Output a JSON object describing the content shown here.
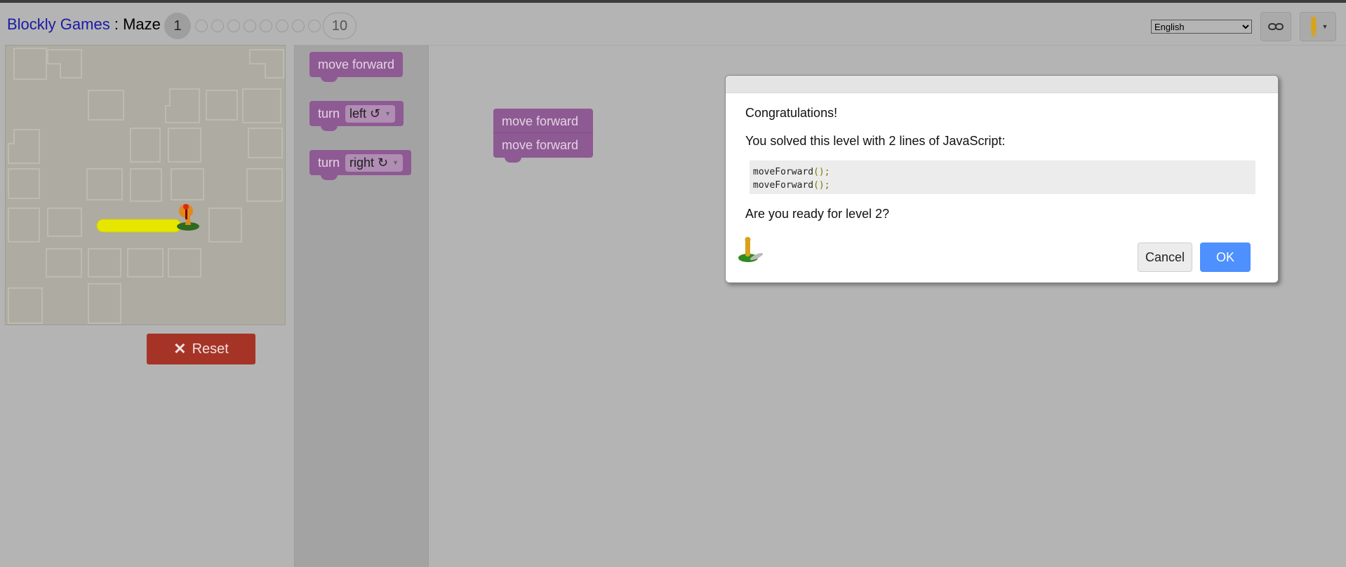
{
  "header": {
    "app_name": "Blockly Games",
    "separator": " : ",
    "game_name": "Maze",
    "current_level": "1",
    "last_level": "10",
    "language": "English",
    "link_icon": "link-icon",
    "user_icon": "pegman-icon"
  },
  "maze": {
    "reset_label": "Reset",
    "reset_icon": "close-icon",
    "path_color": "#e6e600",
    "reset_color": "#a53427"
  },
  "toolbox": {
    "block_color": "#8e5a93",
    "blocks": [
      {
        "label": "move forward"
      },
      {
        "label": "turn",
        "option": "left ↺"
      },
      {
        "label": "turn",
        "option": "right ↻"
      }
    ]
  },
  "workspace": {
    "blocks": [
      {
        "label": "move forward"
      },
      {
        "label": "move forward"
      }
    ]
  },
  "dialog": {
    "heading": "Congratulations!",
    "message": "You solved this level with 2 lines of JavaScript:",
    "code_lines": [
      {
        "fn": "moveForward",
        "args": "();"
      },
      {
        "fn": "moveForward",
        "args": "();"
      }
    ],
    "question": "Are you ready for level 2?",
    "cancel_label": "Cancel",
    "ok_label": "OK",
    "ok_color": "#4d90fe",
    "avatar_icon": "pegman-icon"
  }
}
